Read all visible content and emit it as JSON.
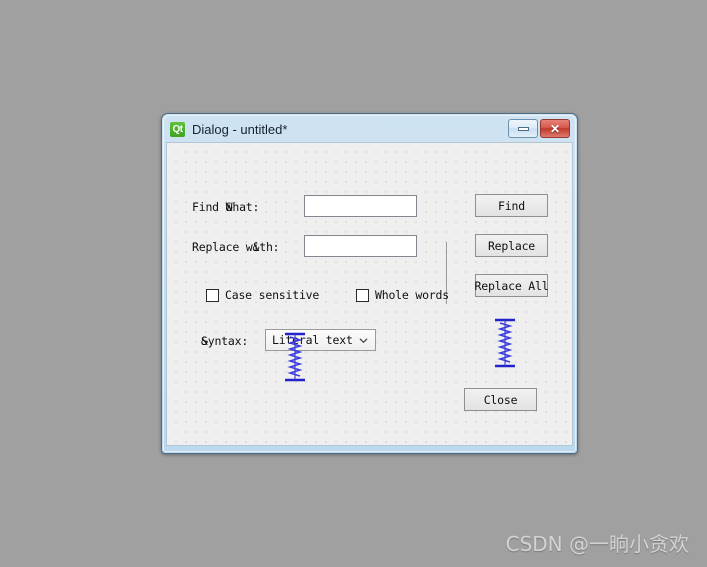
{
  "desktop": {
    "background_color": "#a0a0a0",
    "watermark": "CSDN @一晌小贪欢"
  },
  "dialog": {
    "title": "Dialog - untitled*",
    "app_icon_label": "Qt",
    "accent_color": "#4a6f86",
    "titlebar_buttons": [
      {
        "name": "minimize",
        "glyph": "",
        "color": "#dceaf6"
      },
      {
        "name": "close",
        "glyph": "✕",
        "color": "#c0392c"
      }
    ]
  },
  "form": {
    "background_color": "#efefef",
    "grid_dot_color": "#b9b9b9",
    "fields": [
      {
        "label_prefix": "Find ",
        "label_mnemonic": "&",
        "label_suffix": "What:",
        "value": "",
        "placeholder": ""
      },
      {
        "label_prefix": "Replace w",
        "label_mnemonic": "&",
        "label_suffix": "ith:",
        "value": "",
        "placeholder": ""
      }
    ],
    "checkboxes": [
      {
        "label": "Case sensitive",
        "checked": false
      },
      {
        "label": "Whole words",
        "checked": false
      }
    ],
    "syntax": {
      "label_prefix": "",
      "label_mnemonic": "&",
      "label_suffix": "Syntax:",
      "selected": "Literal text",
      "arrow_icon": "chevron-down-icon"
    },
    "buttons": [
      {
        "name": "find",
        "label": "Find"
      },
      {
        "name": "replace",
        "label": "Replace"
      },
      {
        "name": "replace-all",
        "label": "Replace All"
      },
      {
        "name": "close",
        "label": "Close"
      }
    ],
    "spacers": [
      {
        "name": "vertical-spacer-left",
        "orientation": "vertical"
      },
      {
        "name": "vertical-spacer-right",
        "orientation": "vertical"
      }
    ]
  }
}
